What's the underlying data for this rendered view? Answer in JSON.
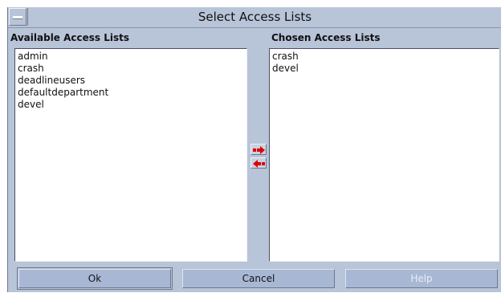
{
  "window": {
    "title": "Select Access Lists"
  },
  "available": {
    "label": "Available Access Lists",
    "items": [
      "admin",
      "crash",
      "deadlineusers",
      "defaultdepartment",
      "devel"
    ]
  },
  "chosen": {
    "label": "Chosen Access Lists",
    "items": [
      "crash",
      "devel"
    ]
  },
  "controls": {
    "add_icon": "arrow-right-icon",
    "remove_icon": "arrow-left-icon",
    "arrow_color": "#e00000"
  },
  "buttons": {
    "ok": "Ok",
    "cancel": "Cancel",
    "help": "Help"
  },
  "colors": {
    "background": "#b8c4d8",
    "button": "#a8b8d4"
  }
}
